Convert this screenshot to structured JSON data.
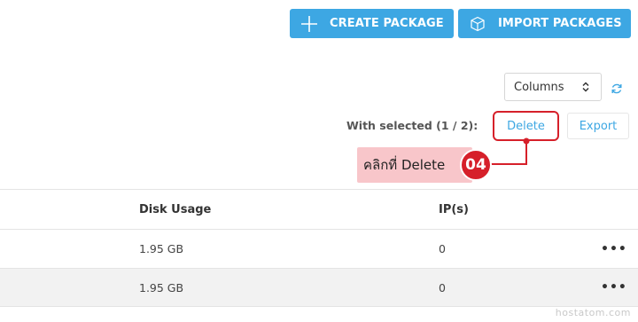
{
  "toolbar": {
    "create_label": "CREATE PACKAGE",
    "import_label": "IMPORT PACKAGES"
  },
  "columns_select": {
    "value": "Columns"
  },
  "bulk": {
    "with_selected": "With selected (1 / 2):",
    "delete_label": "Delete",
    "export_label": "Export"
  },
  "annotation": {
    "text": "คลิกที่ Delete",
    "step": "04"
  },
  "table": {
    "headers": [
      "Disk Usage",
      "IP(s)"
    ],
    "rows": [
      {
        "disk": "1.95 GB",
        "ips": "0",
        "more": "•••"
      },
      {
        "disk": "1.95 GB",
        "ips": "0",
        "more": "•••"
      }
    ]
  },
  "watermark": "hostatom.com",
  "colors": {
    "accent": "#3da7e3",
    "annotation_red": "#d6202a",
    "annotation_pink": "#f8c6ca"
  }
}
